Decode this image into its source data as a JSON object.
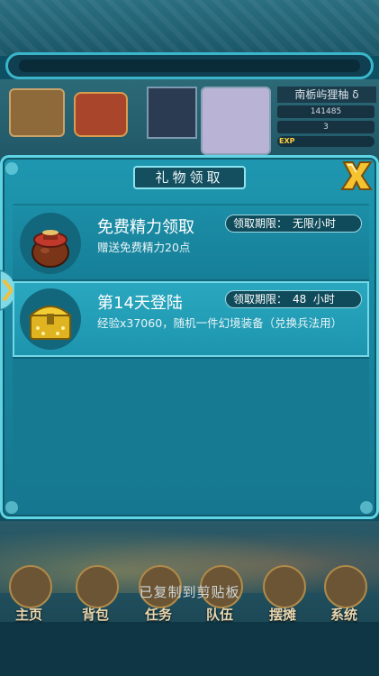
{
  "hud": {
    "player_name": "南栃屿狸柚 δ",
    "stat_1": "141485",
    "stat_2": "3",
    "exp_label": "EXP"
  },
  "dialog": {
    "title": "礼物领取",
    "items": [
      {
        "title": "免费精力领取",
        "description": "赠送免费精力20点",
        "deadline_label": "领取期限：",
        "deadline_value": "无限小时",
        "icon": "energy-pot-icon",
        "selected": false
      },
      {
        "title": "第14天登陆",
        "description": "经验x37060，随机一件幻境装备（兑换兵法用）",
        "deadline_label": "领取期限：",
        "deadline_value": "48  小时",
        "icon": "treasure-chest-icon",
        "selected": true
      }
    ]
  },
  "toast": "已复制到剪贴板",
  "bottom_nav": [
    {
      "label": "主页",
      "icon": "home-icon"
    },
    {
      "label": "背包",
      "icon": "bag-icon"
    },
    {
      "label": "任务",
      "icon": "quest-icon"
    },
    {
      "label": "队伍",
      "icon": "team-icon"
    },
    {
      "label": "摆摊",
      "icon": "stall-icon"
    },
    {
      "label": "系统",
      "icon": "settings-icon"
    }
  ],
  "colors": {
    "dialog_bg": "#1a88a1",
    "selected_row": "#2aa8c0",
    "close_x": "#f5c230"
  }
}
